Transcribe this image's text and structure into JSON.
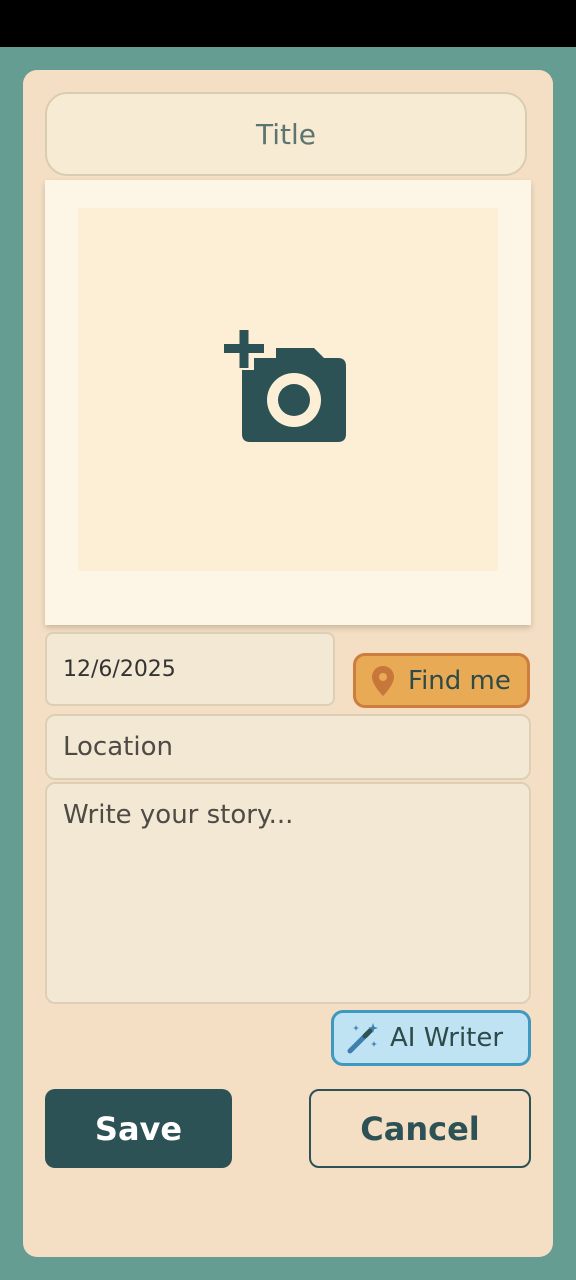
{
  "form": {
    "title_placeholder": "Title",
    "date_value": "12/6/2025",
    "find_me_label": "Find me",
    "location_placeholder": "Location",
    "story_placeholder": "Write your story...",
    "ai_writer_label": "AI Writer",
    "save_label": "Save",
    "cancel_label": "Cancel"
  },
  "icons": {
    "photo": "add-photo-icon",
    "location": "location-pin-icon",
    "ai": "magic-wand-icon"
  },
  "colors": {
    "background": "#659d93",
    "card": "#f5dfc4",
    "primary": "#2c5256",
    "find_me": "#e8aa55",
    "ai_writer": "#bfe3f3"
  }
}
